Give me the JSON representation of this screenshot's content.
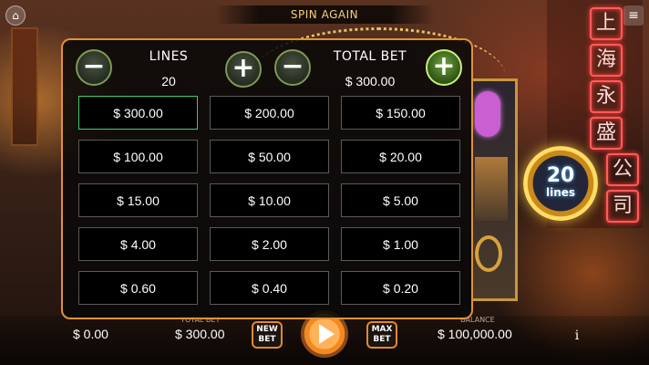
{
  "top": {
    "banner": "SPIN AGAIN",
    "home_icon": "home-icon",
    "menu_icon": "hamburger-menu-icon"
  },
  "badge": {
    "count": "20",
    "word": "lines"
  },
  "panel": {
    "lines_label": "LINES",
    "lines_value": "20",
    "total_bet_label": "TOTAL BET",
    "total_bet_value": "$ 300.00",
    "minus_symbol": "−",
    "plus_symbol": "+",
    "selected_index": 0,
    "bets": [
      "$ 300.00",
      "$ 200.00",
      "$ 150.00",
      "$ 100.00",
      "$ 50.00",
      "$ 20.00",
      "$ 15.00",
      "$ 10.00",
      "$ 5.00",
      "$ 4.00",
      "$ 2.00",
      "$ 1.00",
      "$ 0.60",
      "$ 0.40",
      "$ 0.20"
    ]
  },
  "bottom": {
    "win_value": "$ 0.00",
    "total_bet_label": "TOTAL BET",
    "total_bet_value": "$ 300.00",
    "new_bet_label": "NEW BET",
    "max_bet_label": "MAX BET",
    "balance_label": "BALANCE",
    "balance_value": "$ 100,000.00",
    "info_symbol": "i"
  },
  "neon_chars": [
    "上",
    "海",
    "永",
    "盛",
    "公",
    "司"
  ]
}
